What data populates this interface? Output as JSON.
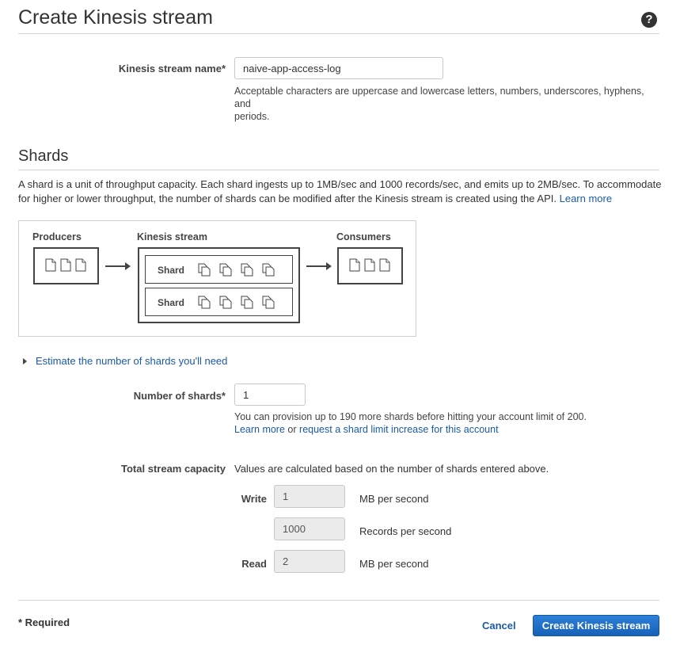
{
  "page": {
    "title": "Create Kinesis stream",
    "help_icon": "question-circle-icon"
  },
  "stream_name": {
    "label": "Kinesis stream name*",
    "value": "naive-app-access-log",
    "help_line1": "Acceptable characters are uppercase and lowercase letters, numbers, underscores, hyphens, and",
    "help_line2": "periods."
  },
  "shards": {
    "title": "Shards",
    "desc_line1": "A shard is a unit of throughput capacity. Each shard ingests up to 1MB/sec and 1000 records/sec, and emits up to 2MB/sec. To accommodate",
    "desc_line2": "for higher or lower throughput, the number of shards can be modified after the Kinesis stream is created using the API.",
    "learn_more": "Learn more"
  },
  "diagram": {
    "producers": "Producers",
    "kinesis_stream": "Kinesis stream",
    "consumers": "Consumers",
    "shard_label": "Shard",
    "document_icon": "document-icon",
    "stacked_document_icon": "stacked-document-icon"
  },
  "estimate": {
    "label": "Estimate the number of shards you'll need"
  },
  "num_shards": {
    "label": "Number of shards*",
    "value": "1",
    "help_line1": "You can provision up to 190 more shards before hitting your account limit of 200.",
    "learn_more": "Learn more",
    "or_text": "or",
    "increase_link": "request a shard limit increase for this account"
  },
  "capacity": {
    "label": "Total stream capacity",
    "note": "Values are calculated based on the number of shards entered above.",
    "write_label": "Write",
    "write_mb": "1",
    "write_mb_unit": "MB per second",
    "write_records": "1000",
    "write_records_unit": "Records per second",
    "read_label": "Read",
    "read_mb": "2",
    "read_mb_unit": "MB per second"
  },
  "footer": {
    "required": "* Required",
    "cancel": "Cancel",
    "create": "Create Kinesis stream"
  },
  "colors": {
    "link": "#1a5aa8",
    "primary_button": "#1f6fc9",
    "disabled_input": "#ebebeb"
  }
}
